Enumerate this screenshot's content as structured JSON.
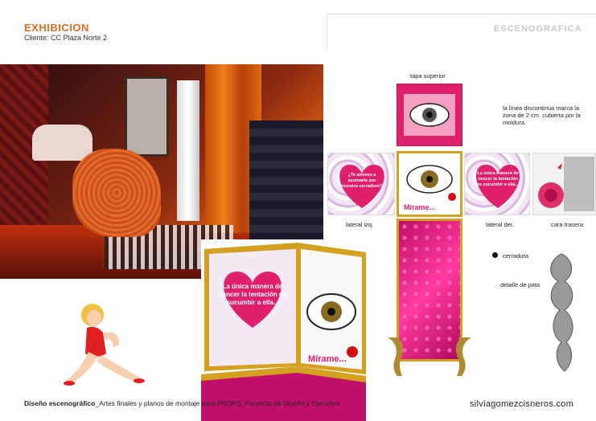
{
  "header": {
    "title": "EXHIBICION",
    "client": "Cliente: CC Plaza Norte 2"
  },
  "right_title": "ESCENOGRAFICA",
  "drawing": {
    "labels": {
      "top": "tapa superior",
      "note": "la línea discontinua marca la zona de 2 cm. cubierta por la moldura",
      "lateral_left": "lateral izq.",
      "lateral_right": "lateral der.",
      "back": "cara trasera",
      "lock": "cerradura",
      "leg_detail": "detalle de pata"
    },
    "left_heart": "¿Te atreves a asomarte por nuestra cerradura?",
    "right_heart": "La única manera de vencer la tentación es sucumbir a ella...",
    "front_caption": "Mírame..."
  },
  "pedestal": {
    "heart_text": "La única manera de vencer la tentación es sucumbir a ella...",
    "caption": "Mírame..."
  },
  "footer": {
    "left_bold": "Diseño escenográfico",
    "left_rest": "_Artes finales y planos de montaje para PROPS, Poryecto de Diseño y Ejecutivo",
    "right": "silviagomezcisneros.com"
  },
  "colors": {
    "accent_orange": "#e06b1f",
    "magenta": "#e0206a",
    "gold": "#d4a020"
  }
}
